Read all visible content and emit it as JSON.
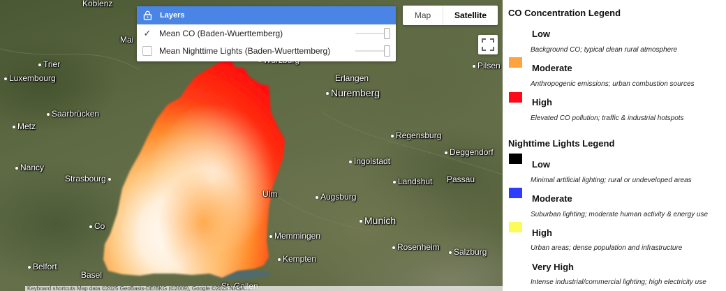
{
  "map": {
    "places": [
      {
        "name": "Koblenz",
        "big": false,
        "dot": false
      },
      {
        "name": "Mai",
        "big": false,
        "dot": false
      },
      {
        "name": "Trier",
        "big": false,
        "dot": true
      },
      {
        "name": "Luxembourg",
        "big": false,
        "dot": true
      },
      {
        "name": "Saarbrücken",
        "big": false,
        "dot": true
      },
      {
        "name": "Metz",
        "big": false,
        "dot": true
      },
      {
        "name": "Nancy",
        "big": false,
        "dot": true
      },
      {
        "name": "Strasbourg",
        "big": false,
        "dot": true
      },
      {
        "name": "Co",
        "big": false,
        "dot": true
      },
      {
        "name": "Belfort",
        "big": false,
        "dot": true
      },
      {
        "name": "Basel",
        "big": false,
        "dot": false
      },
      {
        "name": "Würzburg",
        "big": false,
        "dot": true
      },
      {
        "name": "Erlangen",
        "big": false,
        "dot": false
      },
      {
        "name": "Nuremberg",
        "big": true,
        "dot": true
      },
      {
        "name": "Pilsen",
        "big": false,
        "dot": true
      },
      {
        "name": "Regensburg",
        "big": false,
        "dot": true
      },
      {
        "name": "Deggendorf",
        "big": false,
        "dot": true
      },
      {
        "name": "Ingolstadt",
        "big": false,
        "dot": true
      },
      {
        "name": "Landshut",
        "big": false,
        "dot": true
      },
      {
        "name": "Passau",
        "big": false,
        "dot": false
      },
      {
        "name": "Ulm",
        "big": false,
        "dot": false
      },
      {
        "name": "Augsburg",
        "big": false,
        "dot": true
      },
      {
        "name": "Munich",
        "big": true,
        "dot": true
      },
      {
        "name": "Memmingen",
        "big": false,
        "dot": true
      },
      {
        "name": "Rosenheim",
        "big": false,
        "dot": true
      },
      {
        "name": "Salzburg",
        "big": false,
        "dot": true
      },
      {
        "name": "Kempten",
        "big": false,
        "dot": true
      },
      {
        "name": "St. Gallen",
        "big": false,
        "dot": false
      }
    ],
    "layers_title": "Layers",
    "layers": [
      {
        "label": "Mean CO (Baden-Wuerttemberg)",
        "checked": true,
        "check_glyph": "✓"
      },
      {
        "label": "Mean Nighttime Lights (Baden-Wuerttemberg)",
        "checked": false,
        "check_glyph": ""
      }
    ],
    "map_type": {
      "map_label": "Map",
      "satellite_label": "Satellite",
      "selected": "Satellite"
    },
    "attribution": "Keyboard shortcuts   Map data ©2025 GeoBasis-DE/BKG (©2009), Google ©2025 NASA ..."
  },
  "legend": {
    "co_title": "CO Concentration Legend",
    "co_items": [
      {
        "label": "Low",
        "desc": "Background CO; typical clean rural atmosphere",
        "color": "#ffffff"
      },
      {
        "label": "Moderate",
        "desc": "Anthropogenic emissions; urban combustion sources",
        "color": "#ffa33f"
      },
      {
        "label": "High",
        "desc": "Elevated CO pollution; traffic & industrial hotspots",
        "color": "#ff0a1a"
      }
    ],
    "lights_title": "Nighttime Lights Legend",
    "lights_items": [
      {
        "label": "Low",
        "desc": "Minimal artificial lighting; rural or undeveloped areas",
        "color": "#000000"
      },
      {
        "label": "Moderate",
        "desc": "Suburban lighting; moderate human activity & energy use",
        "color": "#2e3cff"
      },
      {
        "label": "High",
        "desc": "Urban areas; dense population and infrastructure",
        "color": "#fbfb5a"
      },
      {
        "label": "Very High",
        "desc": "Intense industrial/commercial lighting; high electricity use",
        "color": "#ffffff"
      }
    ]
  }
}
